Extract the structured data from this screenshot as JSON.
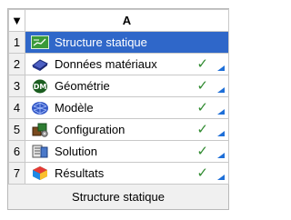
{
  "column_header": "A",
  "corner_arrow": "▼",
  "rows": [
    {
      "num": "1",
      "label": "Structure statique",
      "icon": "static-structural-icon",
      "status": ""
    },
    {
      "num": "2",
      "label": "Données matériaux",
      "icon": "engineering-data-icon",
      "status": "✓"
    },
    {
      "num": "3",
      "label": "Géométrie",
      "icon": "geometry-dm-icon",
      "status": "✓"
    },
    {
      "num": "4",
      "label": "Modèle",
      "icon": "model-icon",
      "status": "✓"
    },
    {
      "num": "5",
      "label": "Configuration",
      "icon": "setup-icon",
      "status": "✓"
    },
    {
      "num": "6",
      "label": "Solution",
      "icon": "solution-icon",
      "status": "✓"
    },
    {
      "num": "7",
      "label": "Résultats",
      "icon": "results-icon",
      "status": "✓"
    }
  ],
  "system_name": "Structure statique",
  "colors": {
    "selection": "#2f67c9",
    "check": "#2f8a2f",
    "triangle": "#1e6fd8"
  }
}
